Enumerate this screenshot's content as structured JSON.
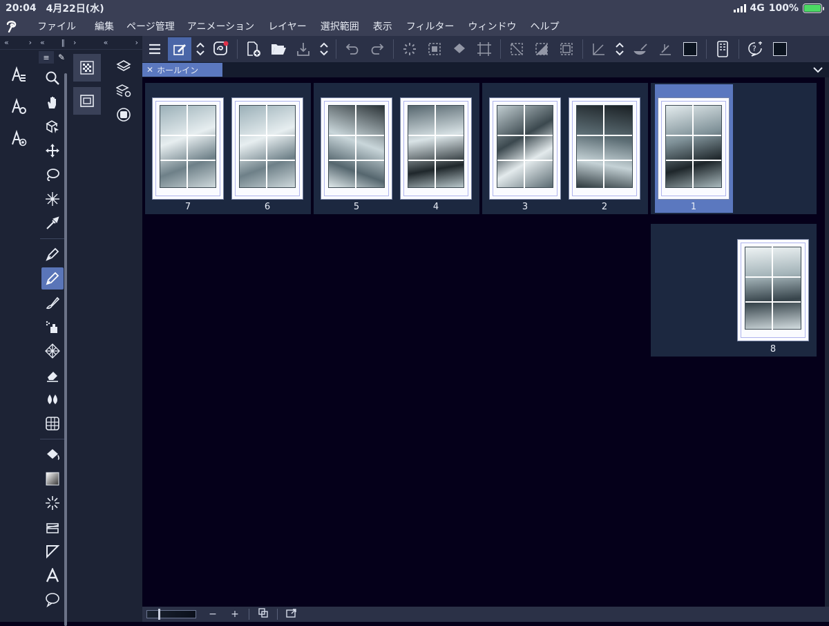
{
  "status": {
    "time": "20:04",
    "date": "4月22日(水)",
    "network": "4G",
    "battery": "100%"
  },
  "menu": [
    "ファイル",
    "編集",
    "ページ管理",
    "アニメーション",
    "レイヤー",
    "選択範囲",
    "表示",
    "フィルター",
    "ウィンドウ",
    "ヘルプ"
  ],
  "tab": {
    "title": "ホールイン"
  },
  "pages": [
    {
      "num": "7"
    },
    {
      "num": "6"
    },
    {
      "num": "5"
    },
    {
      "num": "4"
    },
    {
      "num": "3"
    },
    {
      "num": "2"
    },
    {
      "num": "1"
    },
    {
      "num": "8"
    }
  ],
  "bottom": {
    "zoom_out": "−",
    "zoom_in": "+"
  },
  "colors": {
    "accent": "#5b78bf",
    "panel": "#1d2335",
    "canvas": "#05001a",
    "spread": "#1c2840"
  }
}
